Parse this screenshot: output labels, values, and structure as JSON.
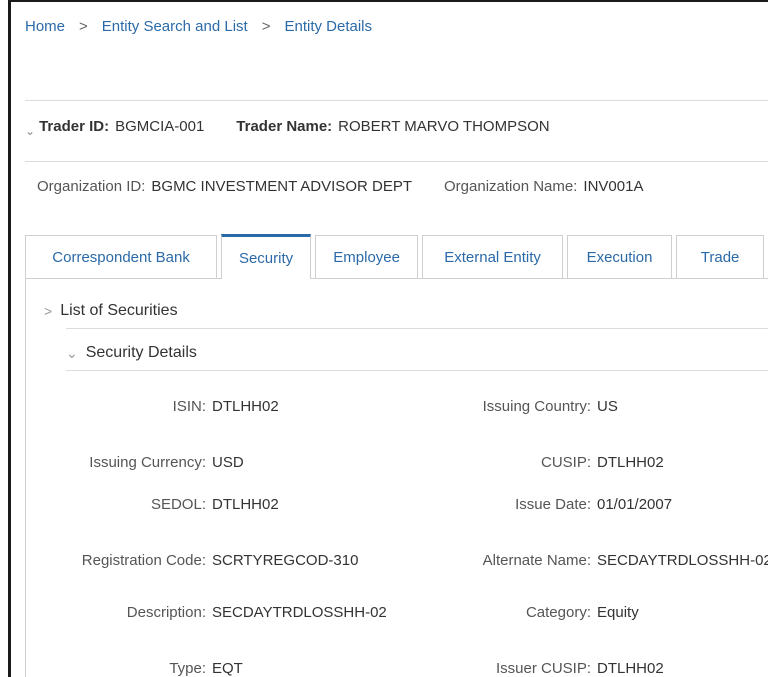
{
  "breadcrumb": {
    "items": [
      "Home",
      "Entity Search and List",
      "Entity Details"
    ],
    "separator": ">"
  },
  "trader": {
    "chevron": "⌄",
    "id_label": "Trader ID:",
    "id_value": "BGMCIA-001",
    "name_label": "Trader Name:",
    "name_value": "ROBERT MARVO THOMPSON"
  },
  "organization": {
    "id_label": "Organization ID:",
    "id_value": "BGMC INVESTMENT ADVISOR DEPT",
    "name_label": "Organization Name:",
    "name_value": "INV001A"
  },
  "tabs": [
    {
      "label": "Correspondent Bank",
      "active": false
    },
    {
      "label": "Security",
      "active": true
    },
    {
      "label": "Employee",
      "active": false
    },
    {
      "label": "External Entity",
      "active": false
    },
    {
      "label": "Execution",
      "active": false
    },
    {
      "label": "Trade",
      "active": false
    }
  ],
  "sections": {
    "list_of_securities": {
      "label": "List of Securities",
      "expanded": false
    },
    "security_details": {
      "label": "Security Details",
      "expanded": true
    }
  },
  "security_details": {
    "isin": {
      "label": "ISIN:",
      "value": "DTLHH02"
    },
    "issuing_country": {
      "label": "Issuing Country:",
      "value": "US"
    },
    "issuing_currency": {
      "label": "Issuing Currency:",
      "value": "USD"
    },
    "cusip": {
      "label": "CUSIP:",
      "value": "DTLHH02"
    },
    "sedol": {
      "label": "SEDOL:",
      "value": "DTLHH02"
    },
    "issue_date": {
      "label": "Issue Date:",
      "value": "01/01/2007"
    },
    "registration_code": {
      "label": "Registration Code:",
      "value": "SCRTYREGCOD-310"
    },
    "alternate_name": {
      "label": "Alternate Name:",
      "value": "SECDAYTRDLOSSHH-02"
    },
    "description": {
      "label": "Description:",
      "value": "SECDAYTRDLOSSHH-02"
    },
    "category": {
      "label": "Category:",
      "value": "Equity"
    },
    "type": {
      "label": "Type:",
      "value": "EQT"
    },
    "issuer_cusip": {
      "label": "Issuer CUSIP:",
      "value": "DTLHH02"
    }
  },
  "colors": {
    "link": "#2b6aa8",
    "border": "#cfcfcf",
    "frame": "#1a1a1a"
  }
}
